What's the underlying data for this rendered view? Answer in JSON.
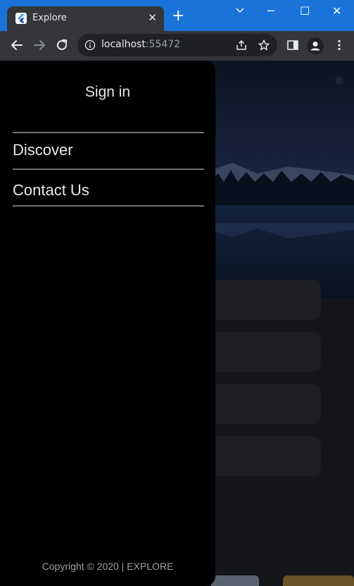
{
  "browser": {
    "tab_title": "Explore",
    "tab_close": "✕",
    "new_tab": "+",
    "url_host": "localhost",
    "url_port": ":55472",
    "window_controls": {
      "minimize": "─",
      "maximize": "☐",
      "close": "✕"
    }
  },
  "drawer": {
    "title": "Sign in",
    "items": [
      {
        "label": "Discover"
      },
      {
        "label": "Contact Us"
      }
    ],
    "footer": "Copyright © 2020 | EXPLORE"
  },
  "icons": [
    "flutter-favicon-icon",
    "back-arrow-icon",
    "forward-arrow-icon",
    "reload-icon",
    "info-icon",
    "share-icon",
    "star-icon",
    "side-panel-icon",
    "profile-icon",
    "menu-dots-icon"
  ],
  "colors": {
    "titlebar": "#1a73d9",
    "tab": "#35363a",
    "drawer": "#000000",
    "page": "#141619"
  }
}
